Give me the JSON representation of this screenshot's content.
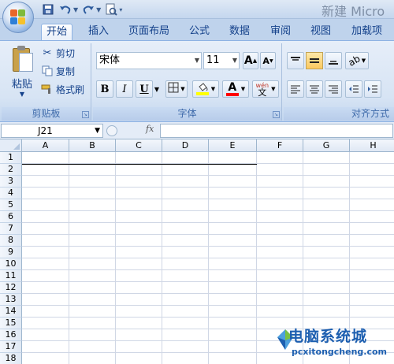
{
  "window": {
    "title": "新建 Micro"
  },
  "quick_access": {
    "save_icon": "save-icon",
    "undo_icon": "undo-icon",
    "redo_icon": "redo-icon",
    "print_preview_icon": "print-preview-icon",
    "customize_icon": "customize-qat-icon"
  },
  "ribbon_tabs": [
    {
      "label": "开始",
      "active": true
    },
    {
      "label": "插入"
    },
    {
      "label": "页面布局"
    },
    {
      "label": "公式"
    },
    {
      "label": "数据"
    },
    {
      "label": "审阅"
    },
    {
      "label": "视图"
    },
    {
      "label": "加载项"
    }
  ],
  "clipboard": {
    "group_label": "剪贴板",
    "paste_label": "粘贴",
    "cut_label": "剪切",
    "copy_label": "复制",
    "format_painter_label": "格式刷"
  },
  "font": {
    "group_label": "字体",
    "font_name": "宋体",
    "font_size": "11",
    "bold_label": "B",
    "italic_label": "I",
    "underline_label": "U",
    "grow_label": "A",
    "shrink_label": "A",
    "font_color_label": "A",
    "phonetic_label": "wén",
    "fill_color": "#ffff00",
    "font_color": "#ff0000"
  },
  "alignment": {
    "group_label": "对齐方式"
  },
  "formula_bar": {
    "name_box": "J21",
    "fx_label": "fx",
    "formula_value": ""
  },
  "grid": {
    "columns": [
      "A",
      "B",
      "C",
      "D",
      "E",
      "F",
      "G",
      "H"
    ],
    "rows": [
      "1",
      "2",
      "3",
      "4",
      "5",
      "6",
      "7",
      "8",
      "9",
      "10",
      "11",
      "12",
      "13",
      "14",
      "15",
      "16",
      "17",
      "18"
    ]
  },
  "watermark": {
    "title": "电脑系统城",
    "url": "pcxitongcheng.com"
  }
}
